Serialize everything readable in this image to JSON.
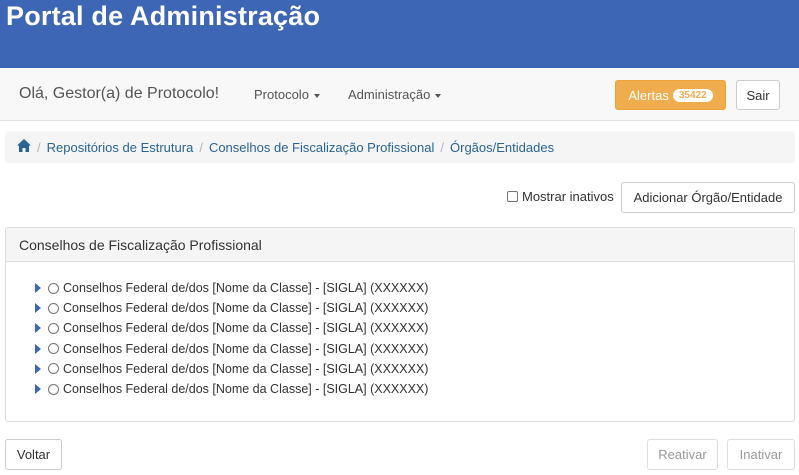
{
  "header": {
    "title": "Portal de Administração"
  },
  "navbar": {
    "greeting": "Olá, Gestor(a) de Protocolo!",
    "menus": [
      "Protocolo",
      "Administração"
    ],
    "alerts_label": "Alertas",
    "alerts_count": "35422",
    "exit_label": "Sair"
  },
  "breadcrumb": {
    "home_icon": "home-icon",
    "items": [
      "Repositórios de Estrutura",
      "Conselhos de Fiscalização Profissional",
      "Órgãos/Entidades"
    ]
  },
  "toolbar": {
    "show_inactive_label": "Mostrar inativos",
    "show_inactive_checked": false,
    "add_label": "Adicionar Órgão/Entidade"
  },
  "panel": {
    "title": "Conselhos de Fiscalização Profissional",
    "items": [
      "Conselhos Federal de/dos [Nome da Classe] - [SIGLA] (XXXXXX)",
      "Conselhos Federal de/dos [Nome da Classe] - [SIGLA] (XXXXXX)",
      "Conselhos Federal de/dos [Nome da Classe] - [SIGLA] (XXXXXX)",
      "Conselhos Federal de/dos [Nome da Classe] - [SIGLA] (XXXXXX)",
      "Conselhos Federal de/dos [Nome da Classe] - [SIGLA] (XXXXXX)",
      "Conselhos Federal de/dos [Nome da Classe] - [SIGLA] (XXXXXX)"
    ]
  },
  "footer": {
    "back_label": "Voltar",
    "reactivate_label": "Reativar",
    "inactivate_label": "Inativar"
  },
  "colors": {
    "banner": "#3d66b4",
    "alerts": "#f0ad4e",
    "link": "#2a6496"
  }
}
